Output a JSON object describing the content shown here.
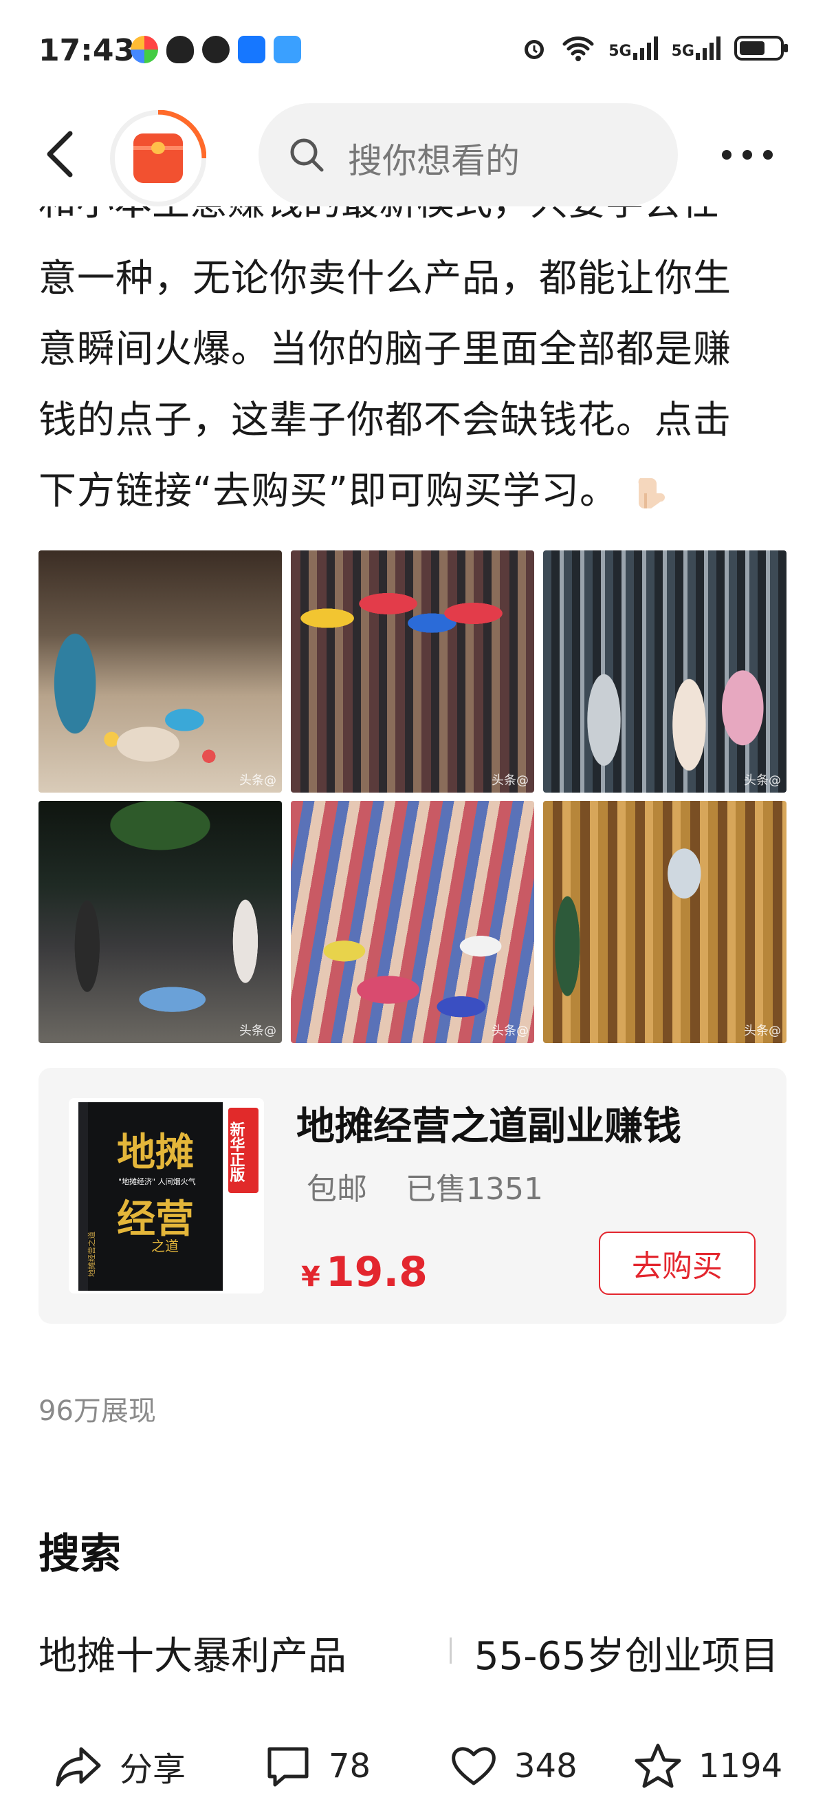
{
  "status_bar": {
    "time": "17:43",
    "signal1": "5G",
    "signal2": "5G"
  },
  "nav": {
    "search_placeholder": "搜你想看的"
  },
  "article": {
    "clipped_line": "和小本生意赚钱的最新模式，只要学会任",
    "lines": [
      "意一种，无论你卖什么产品，都能让你生",
      "意瞬间火爆。当你的脑子里面全部都是赚",
      "钱的点子，这辈子你都不会缺钱花。点击",
      "下方链接“去购买”即可购买学习。"
    ]
  },
  "photos": {
    "watermark": "头条@"
  },
  "product": {
    "title": "地摊经营之道副业赚钱",
    "shipping": "包邮",
    "sold": "已售1351",
    "currency": "¥",
    "price": "19.8",
    "buy_label": "去购买",
    "book_title_1": "地摊",
    "book_title_2": "经营",
    "book_subtitle": "之道",
    "book_badge": "新华正版",
    "book_side": "地摊经营之道",
    "book_tagline": "\"地摊经济\" 人间烟火气"
  },
  "views": "96万展现",
  "search_section": {
    "title": "搜索",
    "items": [
      "地摊十大暴利产品",
      "55-65岁创业项目"
    ]
  },
  "actions": {
    "share": "分享",
    "comments": "78",
    "likes": "348",
    "favorites": "1194"
  },
  "colors": {
    "accent_red": "#e3262e",
    "card_bg": "#f5f5f5",
    "search_bg": "#f2f2f2"
  }
}
